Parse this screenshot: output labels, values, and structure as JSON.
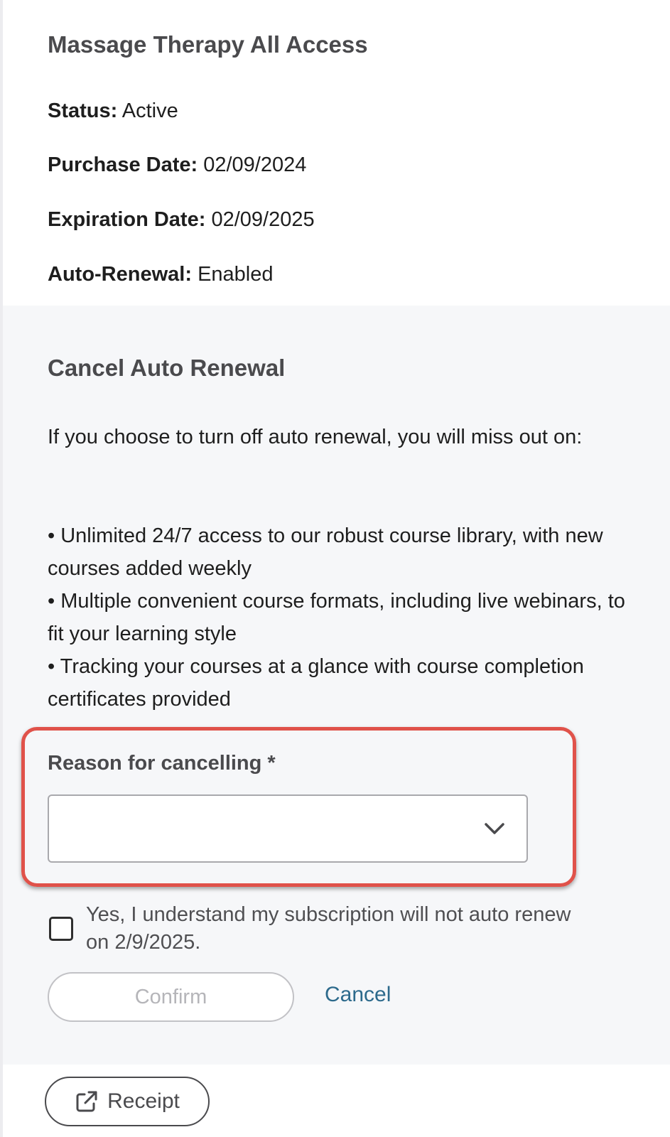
{
  "product": {
    "title": "Massage Therapy All Access",
    "status_label": "Status:",
    "status_value": "Active",
    "purchase_label": "Purchase Date:",
    "purchase_value": "02/09/2024",
    "expiration_label": "Expiration Date:",
    "expiration_value": "02/09/2025",
    "autorenew_label": "Auto-Renewal:",
    "autorenew_value": "Enabled"
  },
  "cancel": {
    "title": "Cancel Auto Renewal",
    "intro": "If you choose to turn off auto renewal, you will miss out on:",
    "benefits": [
      "• Unlimited 24/7 access to our robust course library, with new courses added weekly",
      "• Multiple convenient course formats, including live webinars, to fit your learning style",
      "• Tracking your courses at a glance with course completion certificates provided"
    ],
    "reason_label": "Reason for cancelling *",
    "reason_value": "",
    "acknowledge_text": "Yes, I understand my subscription will not auto renew on 2/9/2025.",
    "acknowledge_checked": false,
    "confirm_label": "Confirm",
    "cancel_label": "Cancel"
  },
  "receipt": {
    "label": "Receipt",
    "icon": "external-link-icon"
  },
  "colors": {
    "highlight": "#e0524a",
    "link": "#2d6a8c",
    "panel_bg": "#f6f7f9"
  }
}
